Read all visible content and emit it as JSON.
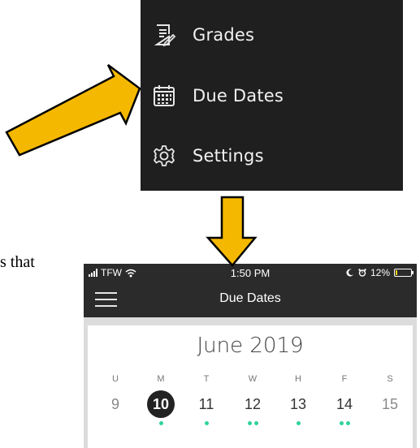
{
  "menu": {
    "items": [
      {
        "label": "Grades",
        "icon": "grades-document-icon"
      },
      {
        "label": "Due Dates",
        "icon": "calendar-icon"
      },
      {
        "label": "Settings",
        "icon": "gear-icon"
      }
    ]
  },
  "fragment_text": "s that",
  "status_bar": {
    "carrier": "TFW",
    "time": "1:50 PM",
    "battery": "12%",
    "battery_level": 0.12
  },
  "nav": {
    "title": "Due Dates"
  },
  "calendar": {
    "month": "June 2019",
    "weekdays": [
      "U",
      "M",
      "T",
      "W",
      "H",
      "F",
      "S"
    ],
    "dates": [
      "9",
      "10",
      "11",
      "12",
      "13",
      "14",
      "15"
    ],
    "selected_index": 1,
    "dot_counts": [
      0,
      1,
      1,
      2,
      1,
      2,
      0
    ]
  },
  "colors": {
    "arrow_fill": "#f5b800",
    "dot": "#2fd39a",
    "menu_bg": "#1f1f1f",
    "nav_bg": "#2b2b2b"
  }
}
